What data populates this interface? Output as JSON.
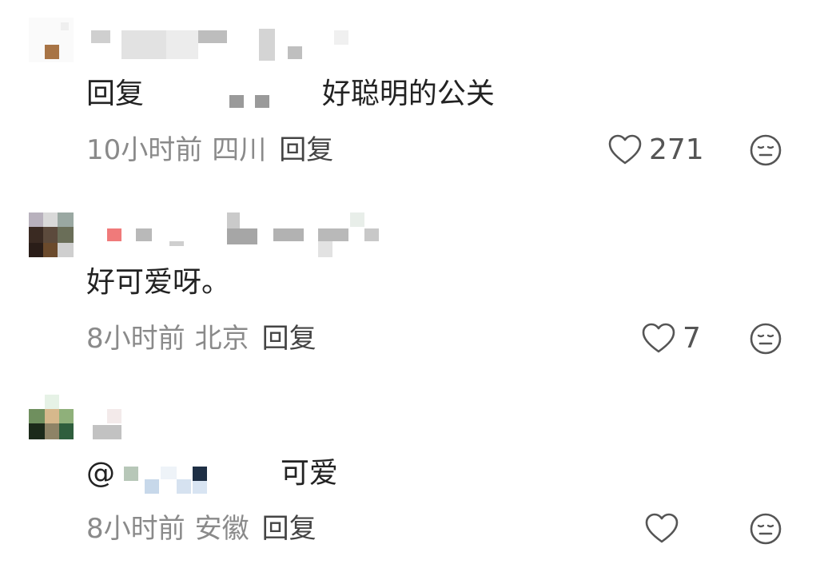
{
  "comments": [
    {
      "reply_prefix": "回复",
      "text": "好聪明的公关",
      "time": "10小时前",
      "location": "四川",
      "reply_label": "回复",
      "likes": "271",
      "like_icon": "heart-outline-icon",
      "dislike_icon": "neutral-face-icon"
    },
    {
      "text": "好可爱呀。",
      "time": "8小时前",
      "location": "北京",
      "reply_label": "回复",
      "likes": "7",
      "like_icon": "heart-outline-icon",
      "dislike_icon": "neutral-face-icon"
    },
    {
      "mention_prefix": "@",
      "text": "可爱",
      "time": "8小时前",
      "location": "安徽",
      "reply_label": "回复",
      "likes": "",
      "like_icon": "heart-outline-icon",
      "dislike_icon": "neutral-face-icon"
    }
  ]
}
